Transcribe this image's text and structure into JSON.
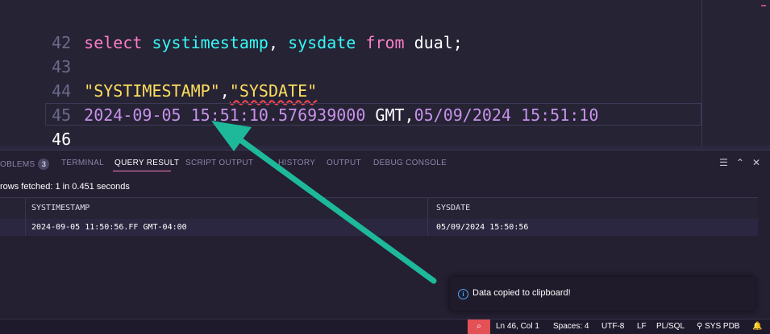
{
  "editor": {
    "lines": [
      {
        "num": "42",
        "tokens": [
          "select",
          "systimestamp",
          ",",
          "sysdate",
          "from",
          "dual;"
        ]
      },
      {
        "num": "43"
      },
      {
        "num": "44",
        "tokens": [
          "\"SYSTIMESTAMP\"",
          ",",
          "\"SYSDATE\""
        ]
      },
      {
        "num": "45",
        "tokens": [
          "2024-09-05 15:51:10.576939000",
          " GMT,",
          "05/09/2024 15:51:10"
        ]
      },
      {
        "num": "46"
      }
    ]
  },
  "panel": {
    "tabs": [
      {
        "label": "OBLEMS",
        "badge": "3"
      },
      {
        "label": "TERMINAL"
      },
      {
        "label": "QUERY RESULT"
      },
      {
        "label": "SCRIPT OUTPUT"
      },
      {
        "label": "HISTORY"
      },
      {
        "label": "OUTPUT"
      },
      {
        "label": "DEBUG CONSOLE"
      }
    ],
    "rows_fetched": "rows fetched: 1 in 0.451 seconds",
    "grid": {
      "columns": [
        "SYSTIMESTAMP",
        "SYSDATE"
      ],
      "rows": [
        {
          "num": "1",
          "cells": [
            "2024-09-05 11:50:56.FF  GMT-04:00",
            "05/09/2024 15:50:56"
          ]
        }
      ]
    }
  },
  "notification": {
    "text": "Data copied to clipboard!"
  },
  "status": {
    "position": "Ln 46, Col 1",
    "spaces": "Spaces: 4",
    "encoding": "UTF-8",
    "eol": "LF",
    "language": "PL/SQL",
    "connection": "SYS PDB"
  },
  "colors": {
    "accent": "#f97ec5",
    "arrow": "#1db99a",
    "zoom": "#e35156"
  }
}
